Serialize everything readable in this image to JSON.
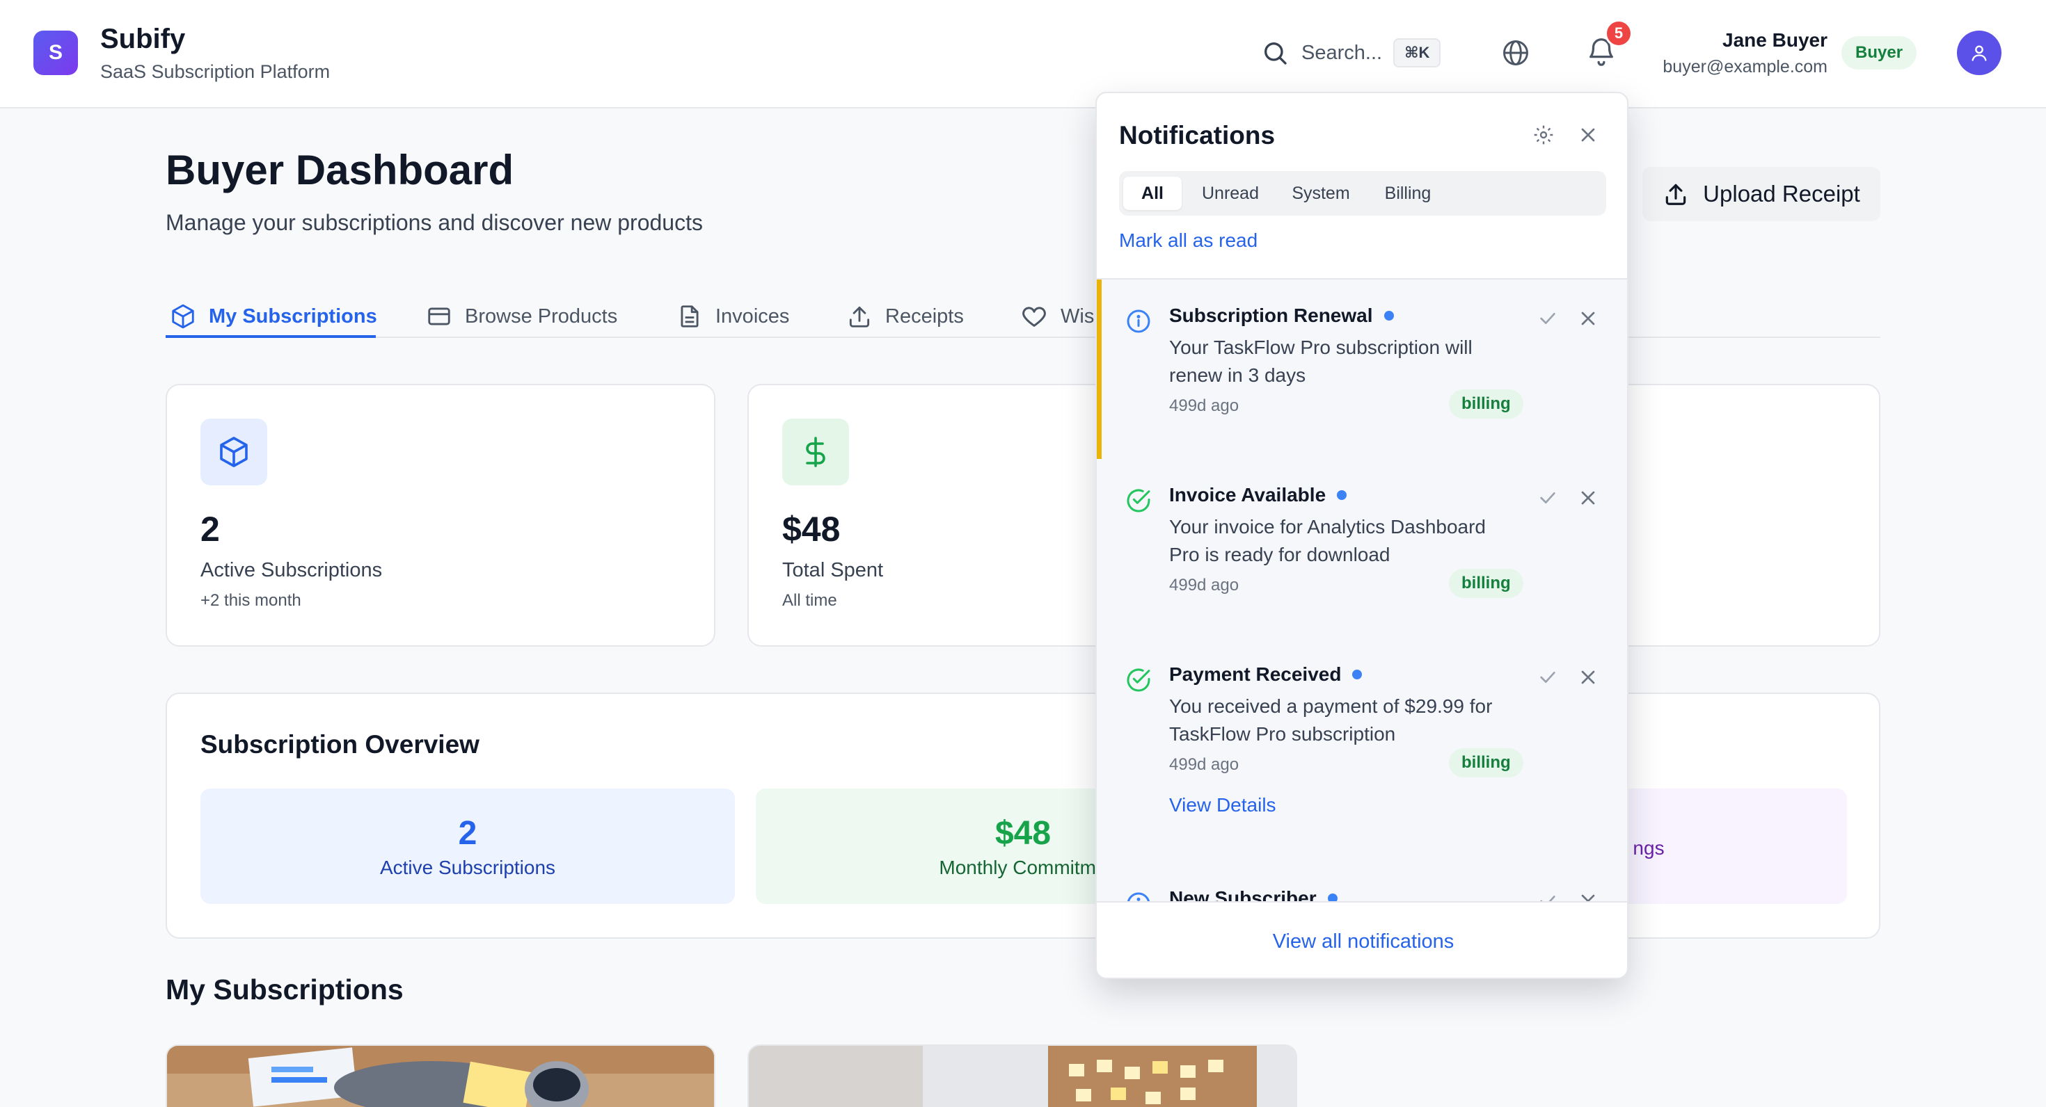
{
  "app": {
    "logo_letter": "S",
    "name": "Subify",
    "tagline": "SaaS Subscription Platform"
  },
  "header": {
    "search_placeholder": "Search...",
    "search_shortcut": "⌘K",
    "notification_count": "5",
    "user_name": "Jane Buyer",
    "user_email": "buyer@example.com",
    "user_role": "Buyer"
  },
  "page": {
    "title": "Buyer Dashboard",
    "subtitle": "Manage your subscriptions and discover new products",
    "upload_button": "Upload Receipt"
  },
  "tabs": [
    {
      "label": "My Subscriptions",
      "icon": "box-icon",
      "active": true
    },
    {
      "label": "Browse Products",
      "icon": "credit-card-icon",
      "active": false
    },
    {
      "label": "Invoices",
      "icon": "file-icon",
      "active": false
    },
    {
      "label": "Receipts",
      "icon": "upload-icon",
      "active": false
    },
    {
      "label": "Wis",
      "icon": "heart-icon",
      "active": false
    }
  ],
  "stats": [
    {
      "value": "2",
      "label": "Active Subscriptions",
      "note": "+2 this month",
      "icon": "box-icon",
      "color": "#2563eb"
    },
    {
      "value": "$48",
      "label": "Total Spent",
      "note": "All time",
      "icon": "dollar-icon",
      "color": "#16a34a"
    }
  ],
  "overview": {
    "title": "Subscription Overview",
    "tiles": [
      {
        "value": "2",
        "label": "Active Subscriptions",
        "color": "#2563eb",
        "bg": "#eef4ff"
      },
      {
        "value": "$48",
        "label": "Monthly Commitme",
        "color": "#15803d",
        "bg": "#eefaf1"
      },
      {
        "value": "",
        "label": "ngs",
        "color": "#7e22ce",
        "bg": "#f8f3ff"
      }
    ]
  },
  "my_subscriptions": {
    "title": "My Subscriptions"
  },
  "notifications": {
    "title": "Notifications",
    "tabs": [
      "All",
      "Unread",
      "System",
      "Billing"
    ],
    "active_tab": "All",
    "mark_all_read": "Mark all as read",
    "items": [
      {
        "title": "Subscription Renewal",
        "body": "Your TaskFlow Pro subscription will renew in 3 days",
        "time": "499d ago",
        "tag": "billing",
        "icon": "info-icon",
        "unread": true
      },
      {
        "title": "Invoice Available",
        "body": "Your invoice for Analytics Dashboard Pro is ready for download",
        "time": "499d ago",
        "tag": "billing",
        "icon": "check-circle-icon",
        "unread": true
      },
      {
        "title": "Payment Received",
        "body": "You received a payment of $29.99 for TaskFlow Pro subscription",
        "time": "499d ago",
        "tag": "billing",
        "icon": "check-circle-icon",
        "unread": true,
        "link": "View Details"
      },
      {
        "title": "New Subscriber",
        "body": "",
        "time": "",
        "tag": "",
        "icon": "info-icon",
        "unread": true
      }
    ],
    "view_all": "View all notifications"
  },
  "colors": {
    "accent": "#2563eb",
    "brand": "#5b5bf0",
    "warning_bar": "#eab308",
    "success": "#16a34a",
    "danger": "#ef4444"
  }
}
